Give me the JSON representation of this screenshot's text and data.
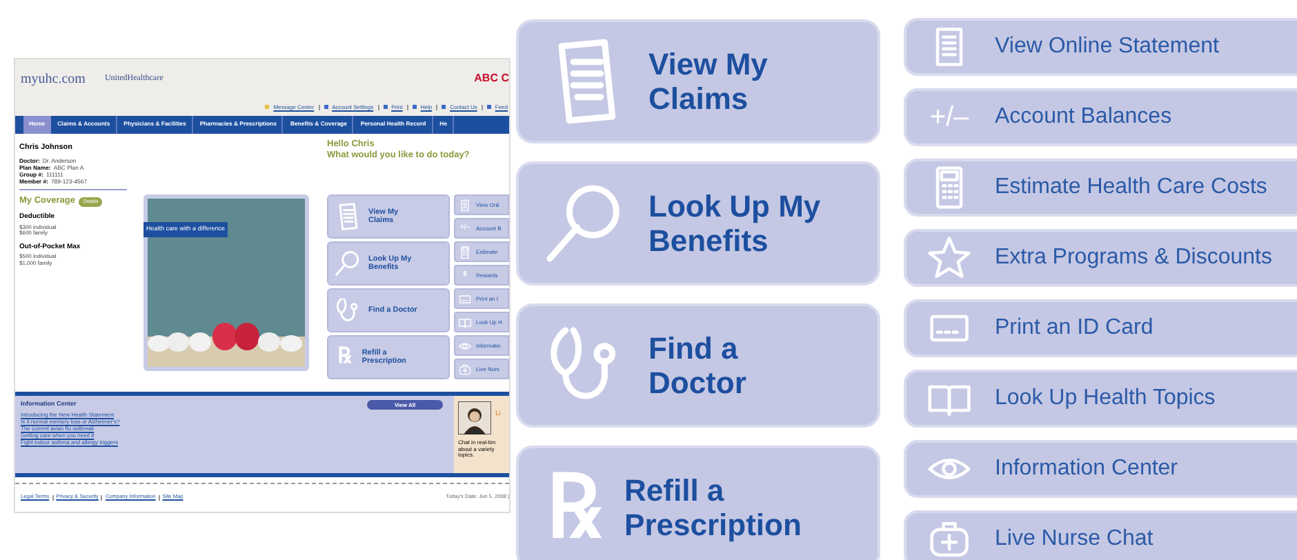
{
  "site": {
    "logo": "myuhc.com",
    "partner_logo": "UnitedHealthcare",
    "employer_logo": "ABC C",
    "utility_links": [
      "Message Center",
      "Account Settings",
      "Print",
      "Help",
      "Contact Us",
      "Feed"
    ],
    "nav": [
      {
        "label": "Home",
        "selected": true
      },
      {
        "label": "Claims & Accounts",
        "selected": false
      },
      {
        "label": "Physicians & Facilities",
        "selected": false
      },
      {
        "label": "Pharmacies & Prescriptions",
        "selected": false
      },
      {
        "label": "Benefits & Coverage",
        "selected": false
      },
      {
        "label": "Personal Health Record",
        "selected": false
      },
      {
        "label": "He",
        "selected": false
      }
    ],
    "member": {
      "name": "Chris Johnson",
      "details": [
        {
          "label": "Doctor:",
          "value": "Dr. Anderson"
        },
        {
          "label": "Plan Name:",
          "value": "ABC Plan A"
        },
        {
          "label": "Group #:",
          "value": "111111"
        },
        {
          "label": "Member #:",
          "value": "789-123-4567"
        }
      ]
    },
    "coverage": {
      "title": "My Coverage",
      "button": "Details",
      "sections": [
        {
          "title": "Deductible",
          "lines": [
            "$300 individual",
            "$600 family"
          ]
        },
        {
          "title": "Out-of-Pocket Max",
          "lines": [
            "$500 individual",
            "$1,000 family"
          ]
        }
      ]
    },
    "greeting": "Hello Chris",
    "prompt": "What would you like to do today?",
    "banner": {
      "caption": "Health care with a difference"
    },
    "big_actions": [
      {
        "label": "View My Claims",
        "kind": "claims"
      },
      {
        "label": "Look Up My Benefits",
        "kind": "benefits"
      },
      {
        "label": "Find a Doctor",
        "kind": "doctor"
      },
      {
        "label": "Refill a Prescription",
        "kind": "glyph",
        "glyph": "℞"
      }
    ],
    "small_actions": [
      {
        "label": "View Onli",
        "kind": "statement"
      },
      {
        "label": "Account B",
        "kind": "glyph",
        "glyph": "+/–"
      },
      {
        "label": "Estimate",
        "kind": "calculator"
      },
      {
        "label": "Rewards",
        "kind": "glyph",
        "glyph": "$"
      },
      {
        "label": "Print an I",
        "kind": "card"
      },
      {
        "label": "Look Up H",
        "kind": "book"
      },
      {
        "label": "Informatio",
        "kind": "eye"
      },
      {
        "label": "Live Nurs",
        "kind": "medkit"
      }
    ],
    "info_center": {
      "title": "Information Center",
      "button": "View All",
      "links": [
        "Introducing the New Health Statement",
        "Is it normal memory loss or Alzheimer's?",
        "The current avian flu outbreak",
        "Getting care when you need it",
        "Fight indoor asthma and allergy triggers"
      ]
    },
    "chat": {
      "heading": "Li",
      "lines": [
        "Chat in real-tim",
        "about a variety",
        "topics."
      ]
    },
    "footer": {
      "links": [
        "Legal Terms",
        "Privacy & Security",
        "Company Information",
        "Site Map"
      ],
      "date": "Today's Date: Jun 5, 2008 |"
    }
  },
  "zoom": {
    "big_actions": [
      {
        "label": "View My Claims",
        "kind": "claims"
      },
      {
        "label": "Look Up My Benefits",
        "kind": "benefits"
      },
      {
        "label": "Find a Doctor",
        "kind": "doctor"
      },
      {
        "label": "Refill a Prescription",
        "kind": "glyph",
        "glyph": "℞"
      }
    ],
    "small_actions": [
      {
        "label": "View Online Statement",
        "kind": "statement"
      },
      {
        "label": "Account Balances",
        "kind": "glyph",
        "glyph": "+/–"
      },
      {
        "label": "Estimate Health Care Costs",
        "kind": "calculator"
      },
      {
        "label": "Extra Programs & Discounts",
        "kind": "star"
      },
      {
        "label": "Print an ID Card",
        "kind": "card"
      },
      {
        "label": "Look Up Health Topics",
        "kind": "book"
      },
      {
        "label": "Information Center",
        "kind": "eye"
      },
      {
        "label": "Live Nurse Chat",
        "kind": "medkit"
      }
    ]
  }
}
